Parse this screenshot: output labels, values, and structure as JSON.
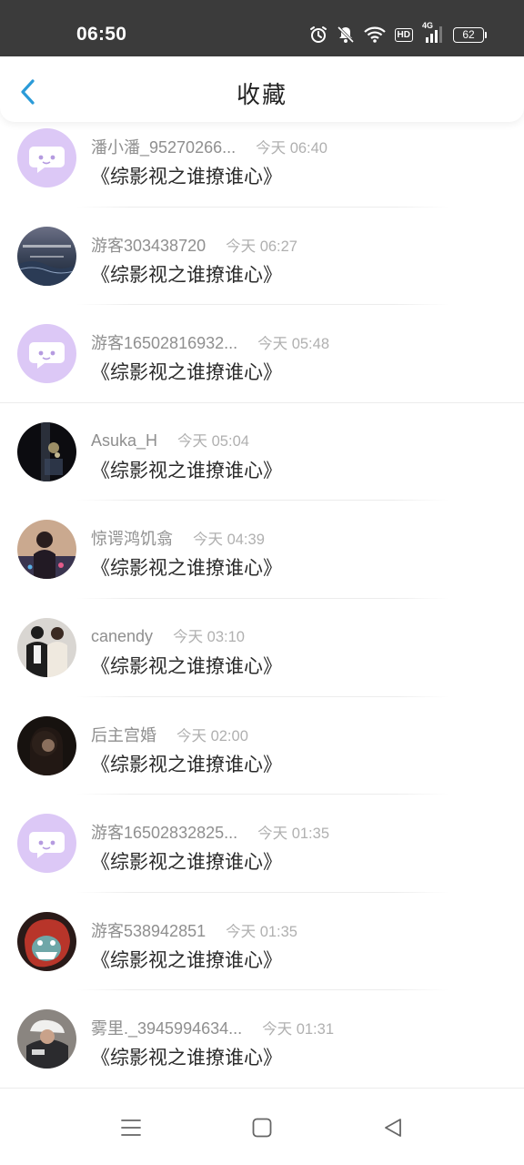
{
  "status_bar": {
    "time": "06:50",
    "network_label": "4G",
    "hd_label": "HD",
    "battery": "62",
    "icons": [
      "alarm-icon",
      "mute-icon",
      "wifi-icon",
      "hd-icon",
      "signal-icon",
      "battery-icon"
    ]
  },
  "header": {
    "title": "收藏",
    "back_icon": "chevron-left-icon",
    "accent_color": "#2b9bd8"
  },
  "favorites": [
    {
      "name": "潘小潘_95270266...",
      "time": "今天 06:40",
      "book": "《综影视之谁撩谁心》",
      "avatar": "default-chat-avatar"
    },
    {
      "name": "游客303438720",
      "time": "今天 06:27",
      "book": "《综影视之谁撩谁心》",
      "avatar": "photo-avatar-sea"
    },
    {
      "name": "游客16502816932...",
      "time": "今天 05:48",
      "book": "《综影视之谁撩谁心》",
      "avatar": "default-chat-avatar"
    },
    {
      "name": "Asuka_H",
      "time": "今天 05:04",
      "book": "《综影视之谁撩谁心》",
      "avatar": "photo-avatar-night"
    },
    {
      "name": "惊谔鸿饥翕",
      "time": "今天 04:39",
      "book": "《综影视之谁撩谁心》",
      "avatar": "photo-avatar-girl"
    },
    {
      "name": "canendy",
      "time": "今天 03:10",
      "book": "《综影视之谁撩谁心》",
      "avatar": "photo-avatar-couple"
    },
    {
      "name": "后主宫婚",
      "time": "今天 02:00",
      "book": "《综影视之谁撩谁心》",
      "avatar": "photo-avatar-dark"
    },
    {
      "name": "游客16502832825...",
      "time": "今天 01:35",
      "book": "《综影视之谁撩谁心》",
      "avatar": "default-chat-avatar"
    },
    {
      "name": "游客538942851",
      "time": "今天 01:35",
      "book": "《综影视之谁撩谁心》",
      "avatar": "photo-avatar-mask"
    },
    {
      "name": "雾里._3945994634...",
      "time": "今天 01:31",
      "book": "《综影视之谁撩谁心》",
      "avatar": "photo-avatar-cap"
    }
  ],
  "nav_bar": {
    "buttons": [
      "menu-icon",
      "home-icon",
      "back-triangle-icon"
    ]
  },
  "colors": {
    "status_bar_bg": "#3b3b3b",
    "default_avatar_bg": "#dcc8f6",
    "name_text": "#8f8f8f",
    "time_text": "#b0b0b0"
  }
}
